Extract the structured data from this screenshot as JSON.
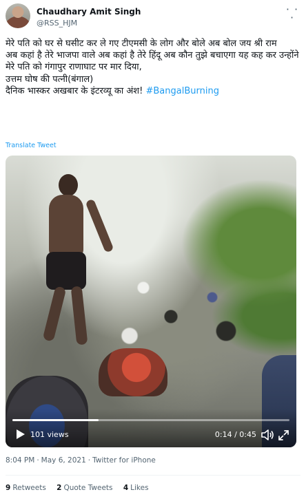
{
  "author": {
    "name": "Chaudhary Amit Singh",
    "handle": "@RSS_HJM"
  },
  "tweet": {
    "lines": [
      "मेरे पति को घर से घसीट कर ले गए टीएमसी के लोग और बोले अब बोल जय श्री राम",
      "अब कहां है तेरे भाजपा वाले अब कहां है तेरे हिंदू अब कौन तुझे बचाएगा यह कह कर उन्होंने मेरे पति को गंगापुर राणाघाट पर मार दिया,",
      "उत्तम घोष की पत्नी(बंगाल)"
    ],
    "last_line_text": "दैनिक भास्कर अखबार के इंटरव्यू का अंश! ",
    "hashtag": "#BangalBurning",
    "translate_label": "Translate Tweet"
  },
  "video": {
    "views": "101 views",
    "time": "0:14 / 0:45",
    "progress": 0.31
  },
  "meta": {
    "time": "8:04 PM",
    "date": "May 6, 2021",
    "source": "Twitter for iPhone"
  },
  "stats": {
    "retweets_count": "9",
    "retweets_label": "Retweets",
    "quotes_count": "2",
    "quotes_label": "Quote Tweets",
    "likes_count": "4",
    "likes_label": "Likes"
  },
  "colors": {
    "accent": "#1d9bf0",
    "text": "#0f1419",
    "muted": "#536471"
  },
  "icons": [
    "more-icon",
    "play-icon",
    "volume-icon",
    "fullscreen-icon"
  ]
}
